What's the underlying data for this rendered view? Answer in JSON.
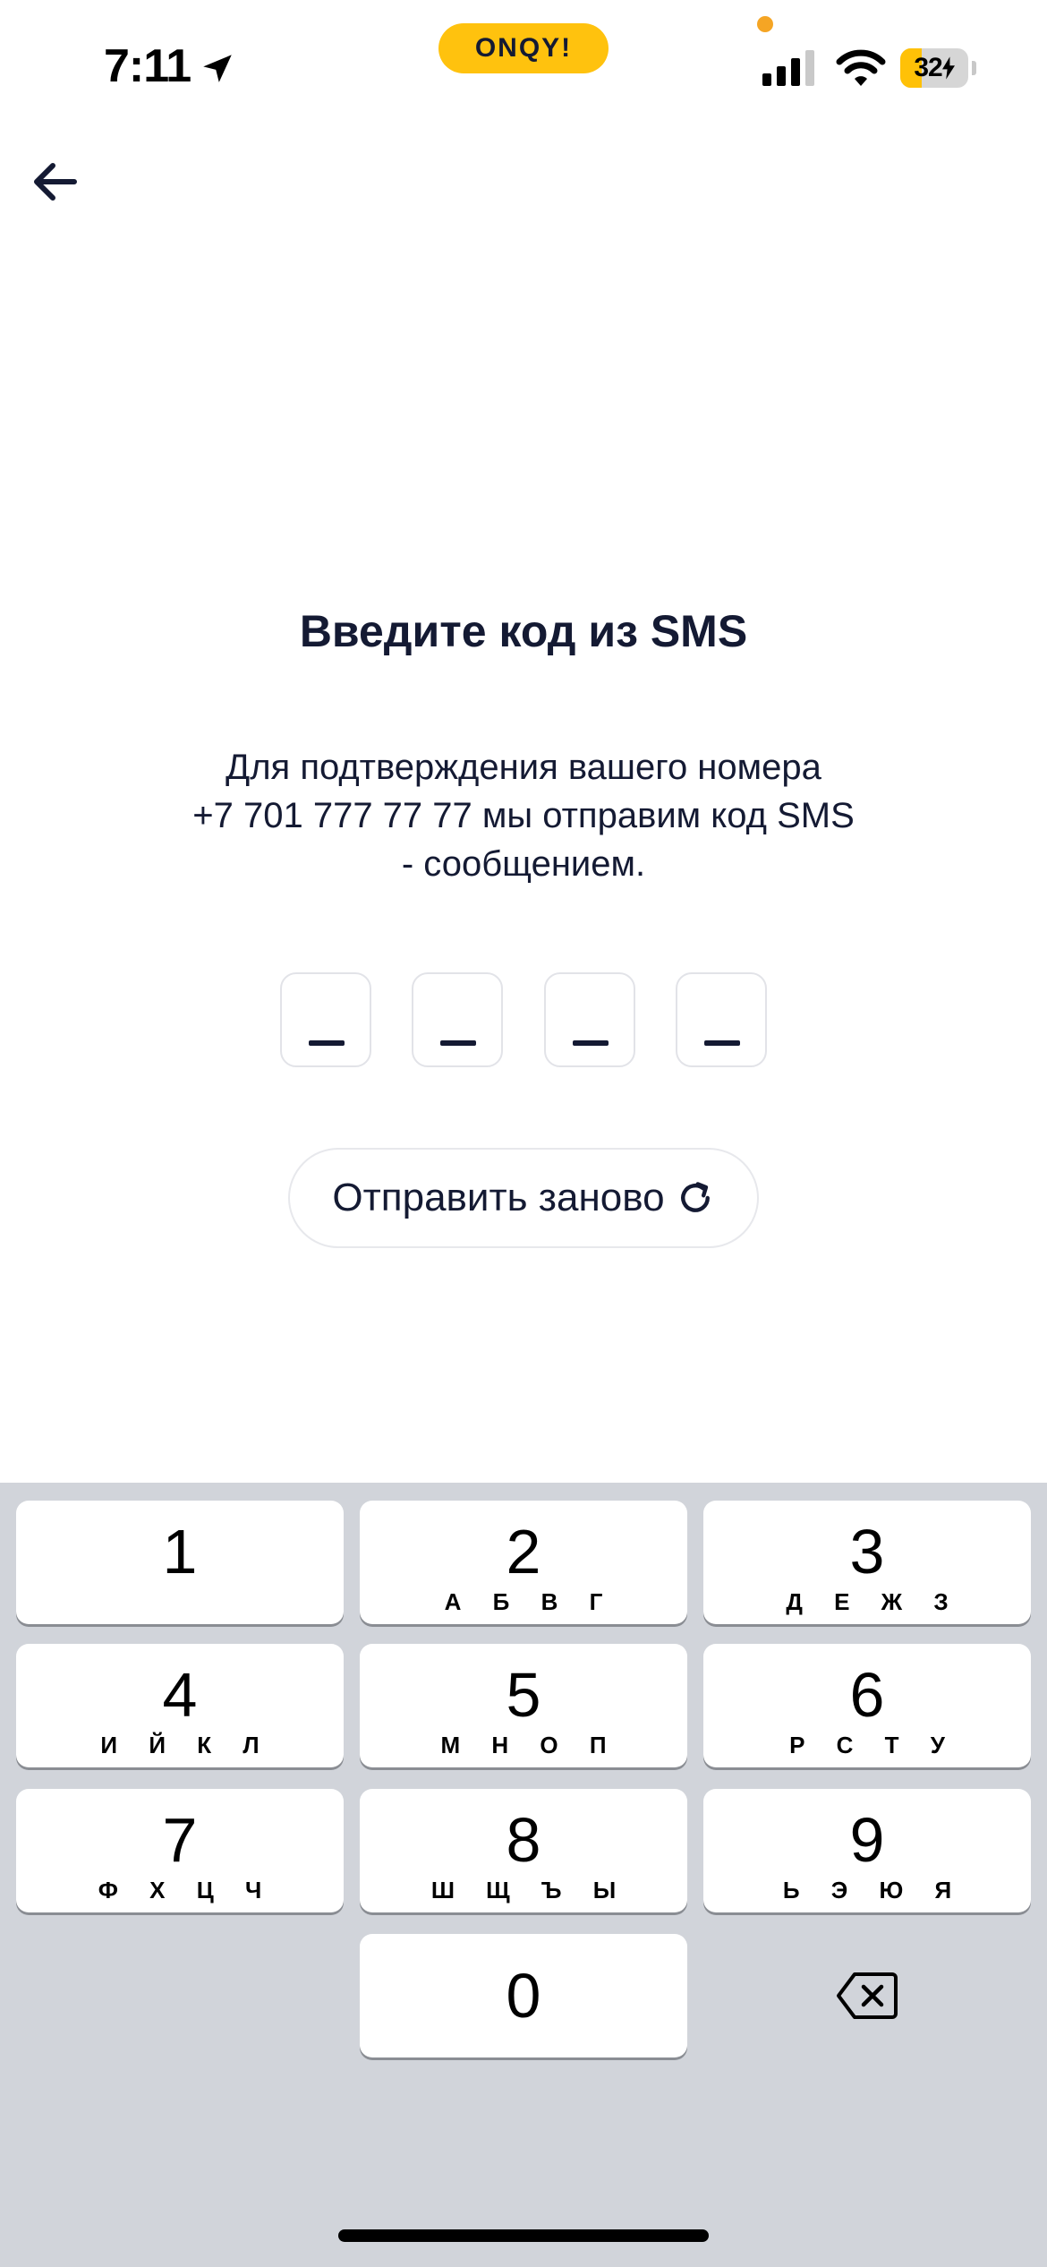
{
  "status_bar": {
    "time": "7:11",
    "brand": "ONQY!",
    "battery": "32",
    "battery_level_percent": 32,
    "accent_color": "#FFC20E"
  },
  "header": {
    "back_icon": "arrow-left-icon"
  },
  "main": {
    "title": "Введите код из SMS",
    "description_line1": "Для подтверждения вашего номера",
    "description_line2": "+7 701 777 77 77 мы отправим код SMS",
    "description_line3": "- сообщением.",
    "code_placeholder": "_",
    "resend_label": "Отправить заново",
    "resend_icon": "refresh-icon"
  },
  "keypad": {
    "keys": [
      {
        "digit": "1",
        "letters": ""
      },
      {
        "digit": "2",
        "letters": "А Б В Г"
      },
      {
        "digit": "3",
        "letters": "Д Е Ж З"
      },
      {
        "digit": "4",
        "letters": "И Й К Л"
      },
      {
        "digit": "5",
        "letters": "М Н О П"
      },
      {
        "digit": "6",
        "letters": "Р С Т У"
      },
      {
        "digit": "7",
        "letters": "Ф Х Ц Ч"
      },
      {
        "digit": "8",
        "letters": "Ш Щ Ъ Ы"
      },
      {
        "digit": "9",
        "letters": "Ь Э Ю Я"
      },
      {
        "digit": "0",
        "letters": ""
      }
    ],
    "delete_icon": "backspace-icon"
  }
}
